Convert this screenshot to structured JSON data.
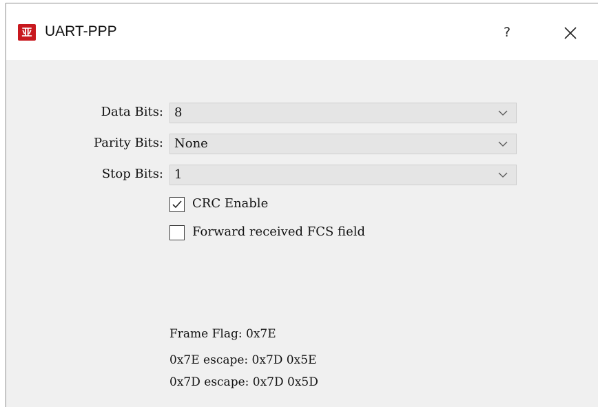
{
  "window": {
    "title": "UART-PPP",
    "app_icon_glyph": "亚",
    "help_label": "?"
  },
  "form": {
    "data_bits": {
      "label": "Data Bits:",
      "value": "8"
    },
    "parity_bits": {
      "label": "Parity Bits:",
      "value": "None"
    },
    "stop_bits": {
      "label": "Stop Bits:",
      "value": "1"
    },
    "crc_enable": {
      "label": "CRC Enable",
      "checked": true
    },
    "forward_fcs": {
      "label": "Forward received FCS field",
      "checked": false
    }
  },
  "info": {
    "frame_flag": "Frame Flag: 0x7E",
    "escape_7e": "0x7E escape: 0x7D 0x5E",
    "escape_7d": "0x7D escape: 0x7D 0x5D"
  },
  "colors": {
    "icon_bg": "#c8181e",
    "dialog_bg": "#f0f0f0",
    "titlebar_bg": "#ffffff",
    "combo_bg": "#e5e5e5"
  },
  "icons": {
    "app": "app-logo-icon",
    "close": "close-icon",
    "dropdown": "chevron-down-icon",
    "check": "checkmark-icon"
  }
}
